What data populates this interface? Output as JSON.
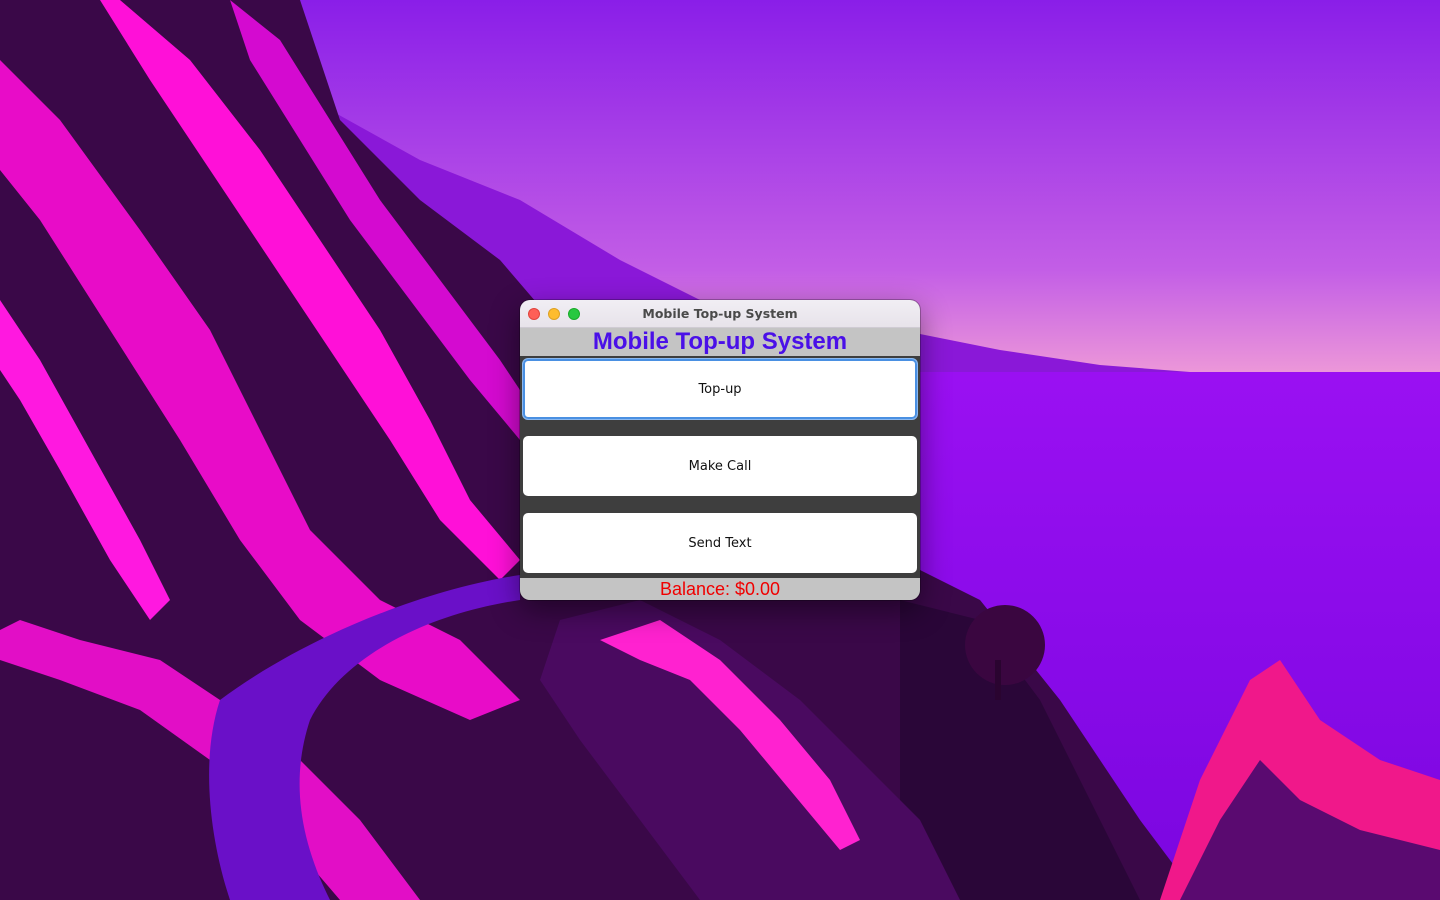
{
  "window": {
    "title": "Mobile Top-up System"
  },
  "app": {
    "header_title": "Mobile Top-up System",
    "buttons": [
      {
        "label": "Top-up"
      },
      {
        "label": "Make Call"
      },
      {
        "label": "Send Text"
      }
    ],
    "balance_text": "Balance: $0.00"
  },
  "colors": {
    "header_title": "#4a10e8",
    "balance": "#f00000",
    "panel_gray": "#c4c4c4",
    "content_dark": "#3e3e3e",
    "focus_ring": "#4a90e2"
  },
  "icons": {
    "close": "close-icon",
    "minimize": "minimize-icon",
    "zoom": "zoom-icon"
  }
}
